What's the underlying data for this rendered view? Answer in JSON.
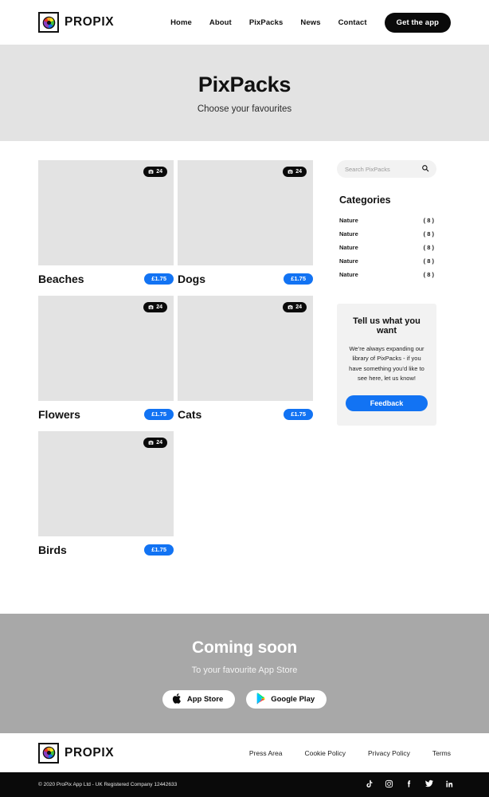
{
  "brand": {
    "name": "PROPIX",
    "logo_icon": "aperture-camera-icon"
  },
  "header": {
    "nav": [
      {
        "label": "Home",
        "name": "home"
      },
      {
        "label": "About",
        "name": "about"
      },
      {
        "label": "PixPacks",
        "name": "pixpacks"
      },
      {
        "label": "News",
        "name": "news"
      },
      {
        "label": "Contact",
        "name": "contact"
      }
    ],
    "cta_label": "Get the app"
  },
  "hero": {
    "title": "PixPacks",
    "subtitle": "Choose your favourites",
    "background": "#e3e3e3"
  },
  "packs": [
    {
      "title": "Beaches",
      "price": "£1.75",
      "count": "24",
      "count_icon": "camera-icon"
    },
    {
      "title": "Dogs",
      "price": "£1.75",
      "count": "24",
      "count_icon": "camera-icon"
    },
    {
      "title": "Flowers",
      "price": "£1.75",
      "count": "24",
      "count_icon": "camera-icon"
    },
    {
      "title": "Cats",
      "price": "£1.75",
      "count": "24",
      "count_icon": "camera-icon"
    },
    {
      "title": "Birds",
      "price": "£1.75",
      "count": "24",
      "count_icon": "camera-icon"
    }
  ],
  "sidebar": {
    "search": {
      "placeholder": "Search PixPacks",
      "value": "",
      "icon": "search-icon"
    },
    "categories_heading": "Categories",
    "categories": [
      {
        "label": "Nature",
        "count": "( 8 )"
      },
      {
        "label": "Nature",
        "count": "( 8 )"
      },
      {
        "label": "Nature",
        "count": "( 8 )"
      },
      {
        "label": "Nature",
        "count": "( 8 )"
      },
      {
        "label": "Nature",
        "count": "( 8 )"
      }
    ],
    "promo": {
      "title": "Tell us what you want",
      "body": "We’re always expanding our library of PixPacks - if you have something you’d like to see here, let us know!",
      "button_label": "Feedback"
    }
  },
  "coming_soon": {
    "title": "Coming soon",
    "subtitle": "To your favourite App Store",
    "stores": [
      {
        "label": "App Store",
        "icon": "apple-icon"
      },
      {
        "label": "Google Play",
        "icon": "google-play-icon"
      }
    ]
  },
  "footer": {
    "links": [
      {
        "label": "Press Area"
      },
      {
        "label": "Cookie Policy"
      },
      {
        "label": "Privacy Policy"
      },
      {
        "label": "Terms"
      }
    ],
    "copyright": "© 2020 ProPix App Ltd - UK Registered Company 12442633",
    "social": [
      {
        "name": "tiktok-icon"
      },
      {
        "name": "instagram-icon"
      },
      {
        "name": "facebook-icon"
      },
      {
        "name": "twitter-icon"
      },
      {
        "name": "linkedin-icon"
      }
    ]
  },
  "colors": {
    "accent_blue": "#1273f3",
    "black": "#0a0a0a",
    "hero_gray": "#e3e3e3",
    "band_gray": "#a8a8a8",
    "panel_gray": "#f2f2f2"
  }
}
